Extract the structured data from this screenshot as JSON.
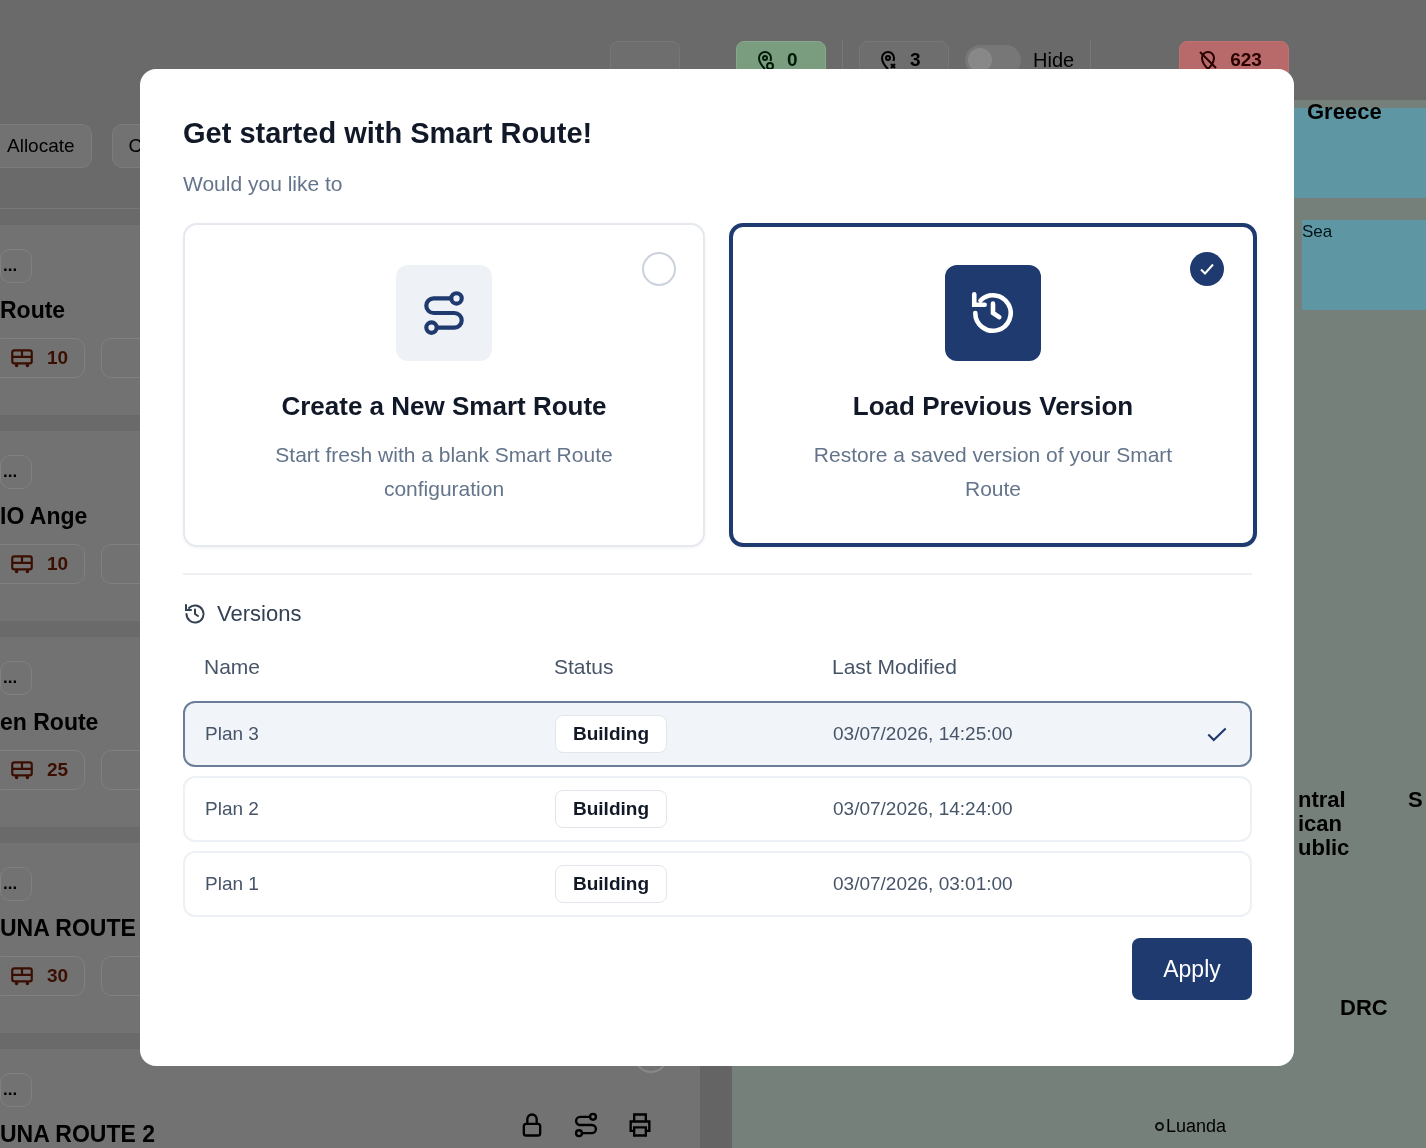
{
  "toolbar": {
    "assigned_count": "0",
    "pending_count": "3",
    "hide_toggle": {
      "label": "Hide",
      "on": false
    },
    "hidden_count": "623"
  },
  "sidebar": {
    "buttons": [
      "Allocate",
      "C"
    ],
    "routes": [
      {
        "tag": "...",
        "name": "Route",
        "vehicles": "10"
      },
      {
        "tag": "...",
        "name": "IO Ange",
        "vehicles": "10"
      },
      {
        "tag": "...",
        "name": "en Route",
        "vehicles": "25"
      },
      {
        "tag": "...",
        "name": "UNA ROUTE",
        "vehicles": "30"
      },
      {
        "tag": "...",
        "name": "UNA ROUTE 2"
      }
    ]
  },
  "map": {
    "labels": [
      {
        "kind": "country",
        "text": "Greece"
      },
      {
        "kind": "sea",
        "text": "Sea"
      },
      {
        "kind": "country",
        "text": "ntral\nican\nublic"
      },
      {
        "kind": "country",
        "text": "S"
      },
      {
        "kind": "country",
        "text": "DRC"
      },
      {
        "kind": "city",
        "text": "Luanda"
      }
    ]
  },
  "dialog": {
    "title": "Get started with Smart Route!",
    "subtitle": "Would you like to",
    "options": [
      {
        "kind": "new",
        "title": "Create a New Smart Route",
        "description": "Start fresh with a blank Smart Route configuration",
        "selected": false
      },
      {
        "kind": "load",
        "title": "Load Previous Version",
        "description": "Restore a saved version of your Smart Route",
        "selected": true
      }
    ],
    "versions": {
      "heading": "Versions",
      "columns": [
        "Name",
        "Status",
        "Last Modified"
      ],
      "rows": [
        {
          "name": "Plan 3",
          "status": "Building",
          "modified": "03/07/2026, 14:25:00",
          "selected": true
        },
        {
          "name": "Plan 2",
          "status": "Building",
          "modified": "03/07/2026, 14:24:00",
          "selected": false
        },
        {
          "name": "Plan 1",
          "status": "Building",
          "modified": "03/07/2026, 03:01:00",
          "selected": false
        }
      ]
    },
    "apply_button": "Apply"
  }
}
